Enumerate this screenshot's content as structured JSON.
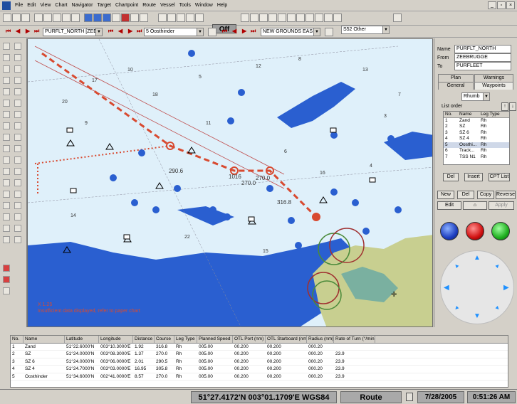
{
  "menubar": {
    "items": [
      "File",
      "Edit",
      "View",
      "Chart",
      "Navigator",
      "Target",
      "Chartpoint",
      "Route",
      "Vessel",
      "Tools",
      "Window",
      "Help"
    ]
  },
  "toolbar": {
    "off_label": "Off",
    "chart_select": "S52 Other"
  },
  "route_bar": {
    "route_select": "PURFLT_NORTH [ZEE",
    "waypoint_select": "5 Oosthinder",
    "chart_select": "NEW GROUNDS EAS"
  },
  "right_panel": {
    "name_label": "Name",
    "name_value": "PURFLT_NORTH",
    "from_label": "From",
    "from_value": "ZEEBRUGGE",
    "to_label": "To",
    "to_value": "PURFLEET",
    "tabs_row1": [
      "Plan",
      "Warnings"
    ],
    "tabs_row2": [
      "General",
      "Waypoints"
    ],
    "leg_type_select": "Rhumb",
    "list_order_label": "List order",
    "wp_columns": [
      "No.",
      "Name",
      "Leg Type"
    ],
    "wp_rows": [
      [
        "1",
        "Zand",
        "Rh"
      ],
      [
        "2",
        "SZ",
        "Rh"
      ],
      [
        "3",
        "SZ 6",
        "Rh"
      ],
      [
        "4",
        "SZ 4",
        "Rh"
      ],
      [
        "5",
        "Oosthi...",
        "Rh"
      ],
      [
        "6",
        "Track...",
        "Rh"
      ],
      [
        "7",
        "TSS N1",
        "Rh"
      ]
    ],
    "del_label": "Del",
    "insert_label": "Insert",
    "cpt_list_label": "CPT List",
    "new_label": "New",
    "del2_label": "Del",
    "copy_label": "Copy",
    "reverse_label": "Reverse",
    "edit_label": "Edit",
    "apply_label": "Apply"
  },
  "map": {
    "zoom_text": "X 1.25",
    "warning_text": "Insufficient data displayed, refer to paper chart",
    "labels": [
      "270.0",
      "290.6",
      "270.0",
      "316.8",
      "1016",
      "0"
    ],
    "depths": [
      "20",
      "17",
      "10",
      "18",
      "5",
      "12",
      "8",
      "13",
      "7",
      "9",
      "11",
      "6",
      "4",
      "14",
      "22",
      "15",
      "3",
      "16"
    ]
  },
  "route_table": {
    "columns": [
      "No.",
      "Name",
      "Latitude",
      "Longitude",
      "Distance",
      "Course",
      "Leg Type",
      "Planned Speed",
      "OTL Port (nm)",
      "OTL Starboard (nm)",
      "Radius (nm)",
      "Rate of Turn (°/min)"
    ],
    "rows": [
      [
        "1",
        "Zand",
        "51°22.6000'N",
        "003°10.3000'E",
        "1.92",
        "316.8",
        "Rh",
        "005.00",
        "00.200",
        "00.200",
        "000.20",
        ""
      ],
      [
        "2",
        "SZ",
        "51°24.0000'N",
        "003°08.3000'E",
        "1.37",
        "270.0",
        "Rh",
        "005.00",
        "00.200",
        "00.200",
        "000.20",
        "23.9"
      ],
      [
        "3",
        "SZ 6",
        "51°24.0000'N",
        "003°06.0000'E",
        "2.01",
        "290.5",
        "Rh",
        "005.00",
        "00.200",
        "00.200",
        "000.20",
        "23.9"
      ],
      [
        "4",
        "SZ 4",
        "51°24.7000'N",
        "003°03.0000'E",
        "16.95",
        "305.8",
        "Rh",
        "005.00",
        "00.200",
        "00.200",
        "000.20",
        "23.9"
      ],
      [
        "5",
        "Oosthinder",
        "51°34.6000'N",
        "002°41.0000'E",
        "8.57",
        "270.0",
        "Rh",
        "005.00",
        "00.200",
        "00.200",
        "000.20",
        "23.9"
      ]
    ]
  },
  "status": {
    "position": "51°27.4172'N 003°01.1709'E WGS84",
    "mode": "Route",
    "date": "7/28/2005",
    "time": "0:51:26 AM"
  },
  "colors": {
    "sea": "#dff0fa",
    "deep": "#2a5fd0",
    "land": "#c8cf90",
    "route": "#d84a30"
  }
}
